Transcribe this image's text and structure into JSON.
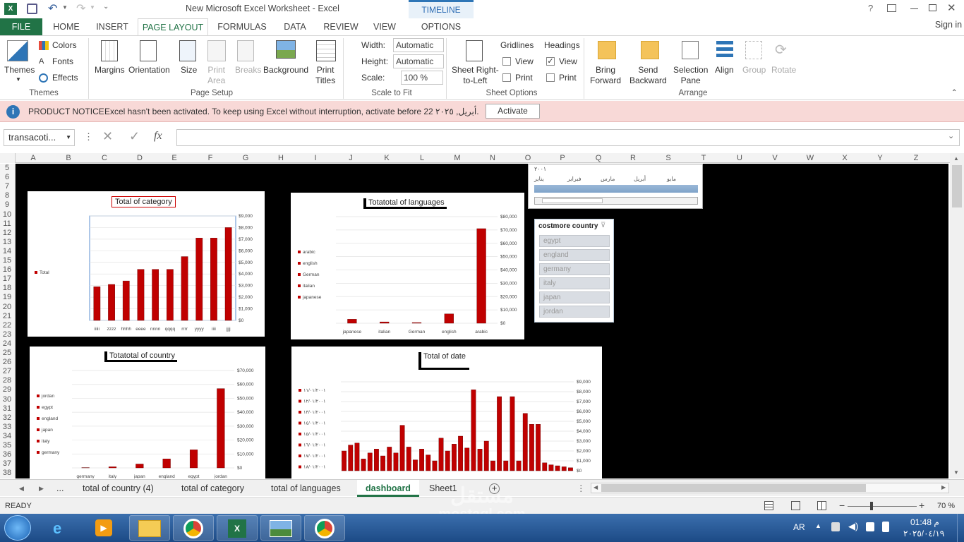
{
  "window": {
    "title": "New Microsoft Excel Worksheet - Excel",
    "context_tab": "TIMELINE TOOLS",
    "help": "?",
    "signin": "Sign in"
  },
  "tabs": [
    "FILE",
    "HOME",
    "INSERT",
    "PAGE LAYOUT",
    "FORMULAS",
    "DATA",
    "REVIEW",
    "VIEW",
    "OPTIONS"
  ],
  "ribbon": {
    "themes": "Themes",
    "colors": "Colors",
    "fonts": "Fonts",
    "effects": "Effects",
    "margins": "Margins",
    "orientation": "Orientation",
    "size": "Size",
    "print_area_1": "Print",
    "print_area_2": "Area",
    "breaks": "Breaks",
    "background": "Background",
    "print_titles_1": "Print",
    "print_titles_2": "Titles",
    "width_label": "Width:",
    "width_value": "Automatic",
    "height_label": "Height:",
    "height_value": "Automatic",
    "scale_label": "Scale:",
    "scale_value": "100 %",
    "sheet_rtl_1": "Sheet Right-",
    "sheet_rtl_2": "to-Left",
    "gridlines": "Gridlines",
    "headings": "Headings",
    "view": "View",
    "print": "Print",
    "bring_forward_1": "Bring",
    "bring_forward_2": "Forward",
    "send_backward_1": "Send",
    "send_backward_2": "Backward",
    "selection_pane_1": "Selection",
    "selection_pane_2": "Pane",
    "align": "Align",
    "group": "Group",
    "rotate": "Rotate",
    "groups": {
      "themes": "Themes",
      "page_setup": "Page Setup",
      "scale": "Scale to Fit",
      "sheet_options": "Sheet Options",
      "arrange": "Arrange"
    }
  },
  "notice": {
    "title": "PRODUCT NOTICE",
    "text": "Excel hasn't been activated. To keep using Excel without interruption, activate before 22 أبريل, ٢٠٢٥.",
    "button": "Activate"
  },
  "formula_bar": {
    "name_box": "transacoti...",
    "fx": "fx",
    "value": ""
  },
  "columns": [
    "A",
    "B",
    "C",
    "D",
    "E",
    "F",
    "G",
    "H",
    "I",
    "J",
    "K",
    "L",
    "M",
    "N",
    "O",
    "P",
    "Q",
    "R",
    "S",
    "T",
    "U",
    "V",
    "W",
    "X",
    "Y",
    "Z"
  ],
  "rows": [
    "5",
    "6",
    "7",
    "8",
    "9",
    "10",
    "11",
    "12",
    "13",
    "14",
    "15",
    "16",
    "17",
    "18",
    "19",
    "20",
    "21",
    "22",
    "23",
    "24",
    "25",
    "26",
    "27",
    "28",
    "29",
    "30",
    "31",
    "32",
    "33",
    "34",
    "35",
    "36",
    "37",
    "38"
  ],
  "timeline": {
    "year": "٢٠٠١",
    "months": [
      "يناير",
      "فبراير",
      "مارس",
      "أبريل",
      "مايو"
    ]
  },
  "slicer": {
    "title": "costmore country",
    "items": [
      "egypt",
      "england",
      "germany",
      "italy",
      "japan",
      "jordan"
    ]
  },
  "sheet_tabs": [
    "...",
    "total of country (4)",
    "total of category",
    "total of languages",
    "dashboard",
    "Sheet1"
  ],
  "active_sheet": "dashboard",
  "status": {
    "ready": "READY",
    "zoom": "70 %"
  },
  "taskbar": {
    "lang": "AR",
    "time": "01:48 م",
    "date": "٢٠٢٥/٠٤/١٩"
  },
  "watermark": {
    "arabic": "مستقل",
    "latin": "mostaql.com"
  },
  "accent": "#217346",
  "bar_color": "#c00000",
  "chart_data": [
    {
      "type": "bar",
      "title": "Total of category",
      "legend": [
        "Total"
      ],
      "categories": [
        "iiiii",
        "zzzz",
        "hhhh",
        "eeee",
        "nnnn",
        "qqqq",
        "rrrr",
        "yyyy",
        "iiii",
        "jjjj"
      ],
      "values": [
        2900,
        3100,
        3400,
        4400,
        4400,
        4400,
        5500,
        7100,
        7100,
        8000
      ],
      "ylim": [
        0,
        9000
      ],
      "ticks": [
        "$0",
        "$1,000",
        "$2,000",
        "$3,000",
        "$4,000",
        "$5,000",
        "$6,000",
        "$7,000",
        "$8,000",
        "$9,000"
      ]
    },
    {
      "type": "bar",
      "title": "Totatotal of languages",
      "legend": [
        "arabic",
        "english",
        "German",
        "italian",
        "japanese"
      ],
      "categories": [
        "japanese",
        "italian",
        "German",
        "english",
        "arabic"
      ],
      "values": [
        3000,
        1000,
        500,
        7000,
        71000
      ],
      "ylim": [
        0,
        80000
      ],
      "ticks": [
        "$0",
        "$10,000",
        "$20,000",
        "$30,000",
        "$40,000",
        "$50,000",
        "$60,000",
        "$70,000",
        "$80,000"
      ]
    },
    {
      "type": "bar",
      "title": "Totatotal of country",
      "legend": [
        "jordan",
        "egypt",
        "england",
        "japan",
        "italy",
        "germany"
      ],
      "categories": [
        "germany",
        "italy",
        "japan",
        "england",
        "egypt",
        "jordan"
      ],
      "values": [
        200,
        800,
        2800,
        6500,
        13000,
        57000
      ],
      "ylim": [
        0,
        70000
      ],
      "ticks": [
        "$0",
        "$10,000",
        "$20,000",
        "$30,000",
        "$40,000",
        "$50,000",
        "$60,000",
        "$70,000"
      ]
    },
    {
      "type": "bar",
      "title": "Total of date",
      "legend": [
        "١١/٠١/٢٠٠١",
        "١٢/٠١/٢٠٠١",
        "١٣/٠١/٢٠٠١",
        "١٤/٠١/٢٠٠١",
        "١٥/٠١/٢٠٠١",
        "١٦/٠١/٢٠٠١",
        "١٧/٠١/٢٠٠١",
        "١٨/٠١/٢٠٠١"
      ],
      "values": [
        2000,
        2600,
        2800,
        1200,
        1800,
        2200,
        1500,
        2400,
        1800,
        4600,
        2400,
        1100,
        2200,
        1600,
        1000,
        3300,
        2000,
        2700,
        3500,
        2300,
        8200,
        2200,
        3000,
        1000,
        7500,
        1000,
        7500,
        1000,
        5800,
        4700,
        4700,
        800,
        600,
        500,
        400,
        300
      ],
      "ylim": [
        0,
        9000
      ],
      "ticks": [
        "$0",
        "$1,000",
        "$2,000",
        "$3,000",
        "$4,000",
        "$5,000",
        "$6,000",
        "$7,000",
        "$8,000",
        "$9,000"
      ]
    }
  ]
}
